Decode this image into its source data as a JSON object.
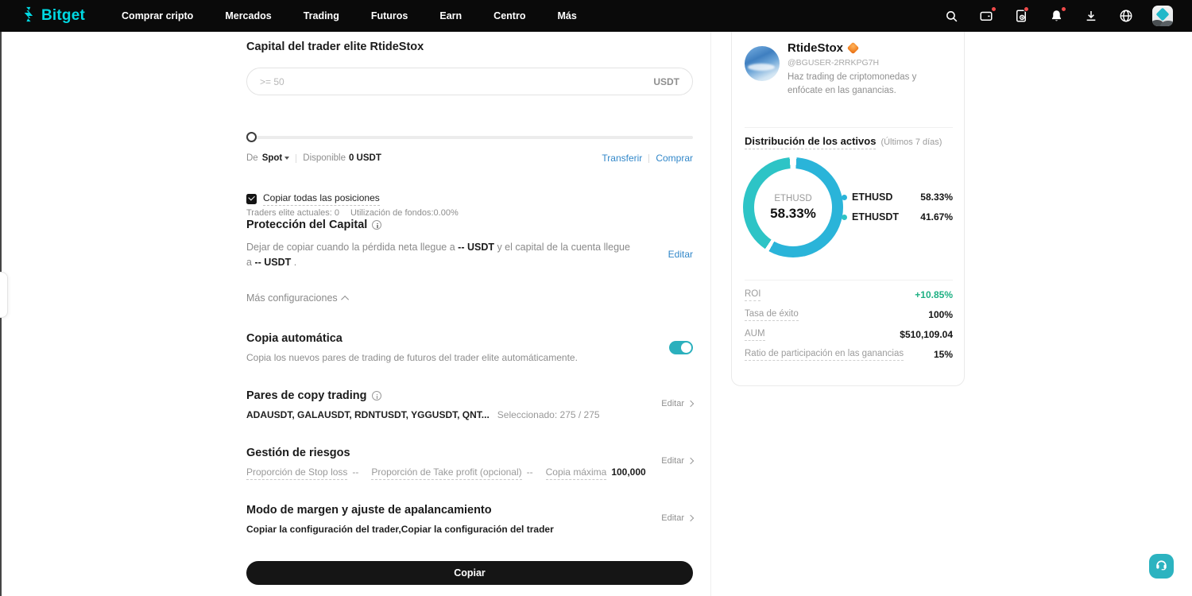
{
  "nav": {
    "logo": "Bitget",
    "items": [
      "Comprar cripto",
      "Mercados",
      "Trading",
      "Futuros",
      "Earn",
      "Centro",
      "Más"
    ],
    "icon_names": [
      "search-icon",
      "wallet-icon",
      "orders-icon",
      "bell-icon",
      "download-icon",
      "globe-icon",
      "avatar"
    ]
  },
  "form": {
    "title": "Capital del trader elite RtideStox",
    "amount_placeholder": ">= 50",
    "amount_unit": "USDT",
    "from_label": "De",
    "from_value": "Spot",
    "available_label": "Disponible",
    "available_value": "0 USDT",
    "transfer_link": "Transferir",
    "buy_link": "Comprar",
    "copy_all_label": "Copiar todas las posiciones",
    "traders_info": "Traders elite actuales: 0",
    "utilization_info": "Utilización de fondos:0.00%",
    "protection": {
      "title": "Protección del Capital",
      "text_1": "Dejar de copiar cuando la pérdida neta llegue a ",
      "value_1": "-- USDT",
      "text_2": " y el capital de la cuenta llegue a ",
      "value_2": "-- USDT",
      "text_3": " .",
      "edit": "Editar"
    },
    "more_settings": "Más configuraciones",
    "auto_copy": {
      "title": "Copia automática",
      "description": "Copia los nuevos pares de trading de futuros del trader elite automáticamente.",
      "enabled": true
    },
    "pairs": {
      "title": "Pares de copy trading",
      "list": "ADAUSDT, GALAUSDT, RDNTUSDT, YGGUSDT, QNT...",
      "selected": "Seleccionado: 275 / 275",
      "edit": "Editar"
    },
    "risk": {
      "title": "Gestión de riesgos",
      "stop_loss_label": "Proporción de Stop loss",
      "stop_loss_value": "--",
      "take_profit_label": "Proporción de Take profit (opcional)",
      "take_profit_value": "--",
      "max_copy_label": "Copia máxima",
      "max_copy_value": "100,000",
      "edit": "Editar"
    },
    "margin": {
      "title": "Modo de margen y ajuste de apalancamiento",
      "description": "Copiar la configuración del trader,Copiar la configuración del trader",
      "edit": "Editar"
    },
    "submit": "Copiar"
  },
  "profile": {
    "name": "RtideStox",
    "handle": "@BGUSER-2RRKPG7H",
    "bio": "Haz trading de criptomonedas y enfócate en las ganancias.",
    "distribution_title": "Distribución de los activos",
    "distribution_period": "(Últimos 7 días)",
    "stats": [
      {
        "label": "ROI",
        "value": "+10.85%",
        "color": "#1eb083"
      },
      {
        "label": "Tasa de éxito",
        "value": "100%"
      },
      {
        "label": "AUM",
        "value": "$510,109.04"
      },
      {
        "label": "Ratio de participación en las ganancias",
        "value": "15%"
      }
    ]
  },
  "chart_data": {
    "type": "pie",
    "donut": true,
    "title": "Distribución de los activos (Últimos 7 días)",
    "labels": [
      "ETHUSD",
      "ETHUSDT"
    ],
    "values": [
      58.33,
      41.67
    ],
    "display_values": [
      "58.33%",
      "41.67%"
    ],
    "colors": [
      "#2ab4d9",
      "#2dc4c6"
    ],
    "center_label": "ETHUSD",
    "center_value": "58.33%",
    "legend_position": "right"
  },
  "colors": {
    "brand_cyan": "#00d9e3",
    "link_blue": "#3187c9",
    "toggle_teal": "#2bb0bd",
    "roi_green": "#1eb083",
    "badge_red": "#ef4a4a"
  }
}
